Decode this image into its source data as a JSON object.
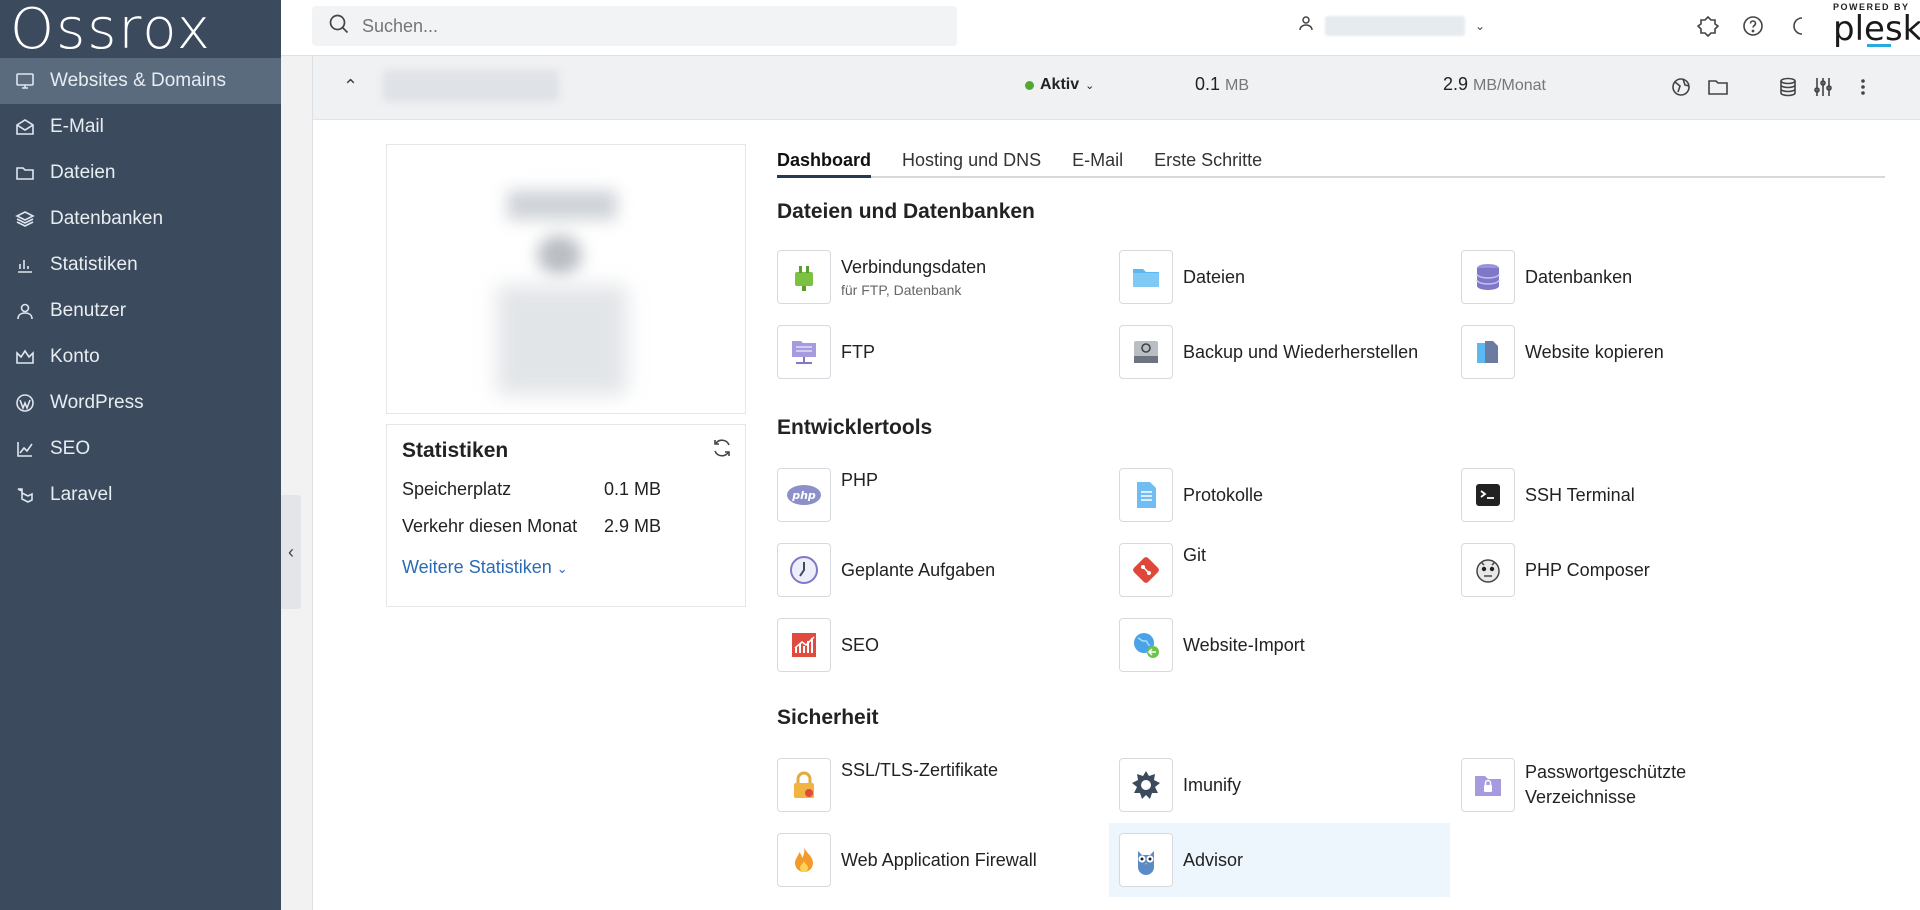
{
  "sidebar": {
    "logo": "Ossrox",
    "items": [
      {
        "label": "Websites & Domains",
        "icon": "monitor-icon"
      },
      {
        "label": "E-Mail",
        "icon": "mail-icon"
      },
      {
        "label": "Dateien",
        "icon": "folder-icon"
      },
      {
        "label": "Datenbanken",
        "icon": "layers-icon"
      },
      {
        "label": "Statistiken",
        "icon": "bar-chart-icon"
      },
      {
        "label": "Benutzer",
        "icon": "user-icon"
      },
      {
        "label": "Konto",
        "icon": "crown-icon"
      },
      {
        "label": "WordPress",
        "icon": "wordpress-icon"
      },
      {
        "label": "SEO",
        "icon": "chart-up-icon"
      },
      {
        "label": "Laravel",
        "icon": "laravel-icon"
      }
    ]
  },
  "topbar": {
    "search_placeholder": "Suchen...",
    "brand_small": "POWERED BY",
    "brand_name": "plesk"
  },
  "domain_row": {
    "status": "Aktiv",
    "disk_value": "0.1",
    "disk_unit": "MB",
    "traffic_value": "2.9",
    "traffic_unit": "MB/Monat"
  },
  "stats": {
    "title": "Statistiken",
    "disk_label": "Speicherplatz",
    "disk_value": "0.1 MB",
    "traffic_label": "Verkehr diesen Monat",
    "traffic_value": "2.9 MB",
    "more": "Weitere Statistiken"
  },
  "tabs": [
    "Dashboard",
    "Hosting und DNS",
    "E-Mail",
    "Erste Schritte"
  ],
  "sections": {
    "files": "Dateien und Datenbanken",
    "dev": "Entwicklertools",
    "security": "Sicherheit"
  },
  "tools": {
    "connection": {
      "label": "Verbindungsdaten",
      "sub": "für FTP, Datenbank"
    },
    "files": {
      "label": "Dateien"
    },
    "databases": {
      "label": "Datenbanken"
    },
    "ftp": {
      "label": "FTP"
    },
    "backup": {
      "label": "Backup und Wiederherstellen"
    },
    "copy": {
      "label": "Website kopieren"
    },
    "php": {
      "label": "PHP"
    },
    "logs": {
      "label": "Protokolle"
    },
    "ssh": {
      "label": "SSH Terminal"
    },
    "cron": {
      "label": "Geplante Aufgaben"
    },
    "git": {
      "label": "Git"
    },
    "composer": {
      "label": "PHP Composer"
    },
    "seo": {
      "label": "SEO"
    },
    "import": {
      "label": "Website-Import"
    },
    "ssl": {
      "label": "SSL/TLS-Zertifikate"
    },
    "imunify": {
      "label": "Imunify"
    },
    "protected": {
      "label": "Passwortgeschützte Verzeichnisse"
    },
    "waf": {
      "label": "Web Application Firewall"
    },
    "advisor": {
      "label": "Advisor"
    }
  },
  "colors": {
    "sidebar_bg": "#3b4a5c",
    "sidebar_active": "#5a6b7e",
    "status_green": "#53a832",
    "link_blue": "#2a6cb4",
    "highlight_bg": "#eef6fd"
  }
}
